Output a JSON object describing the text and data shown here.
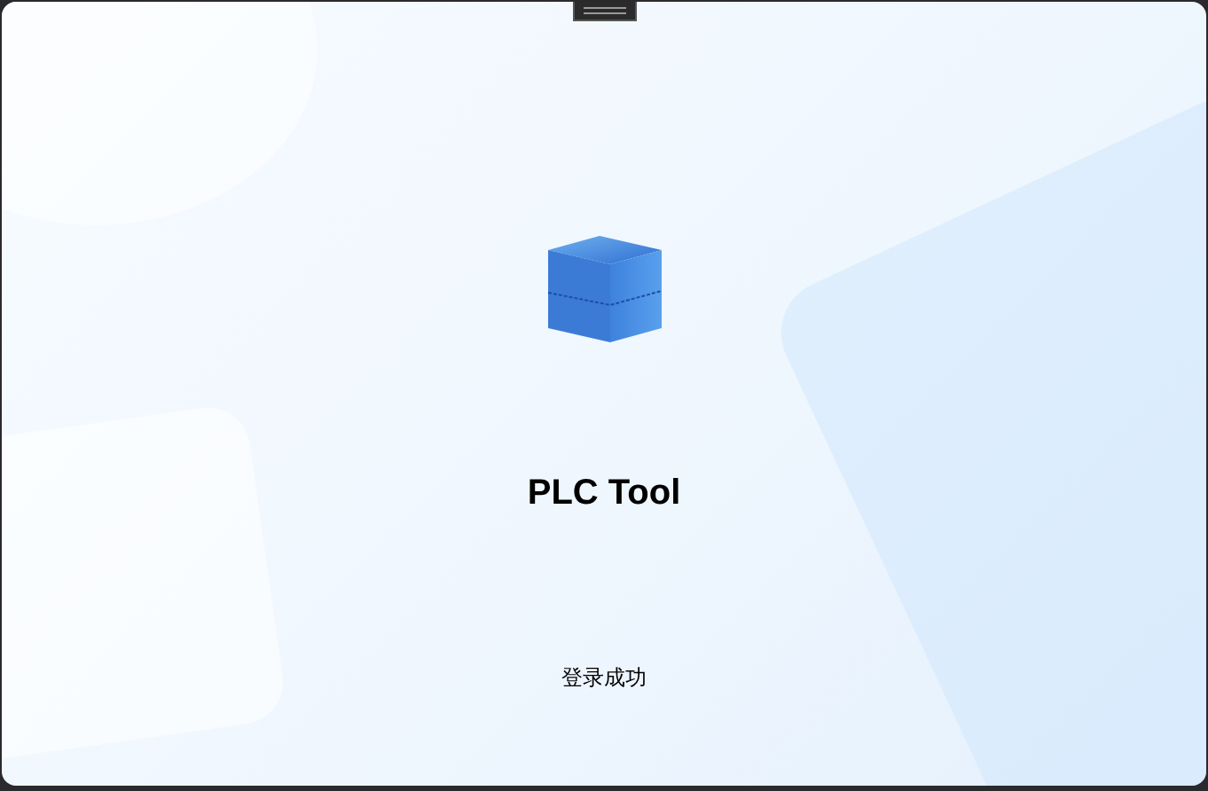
{
  "splash": {
    "title": "PLC Tool",
    "status": "登录成功"
  }
}
